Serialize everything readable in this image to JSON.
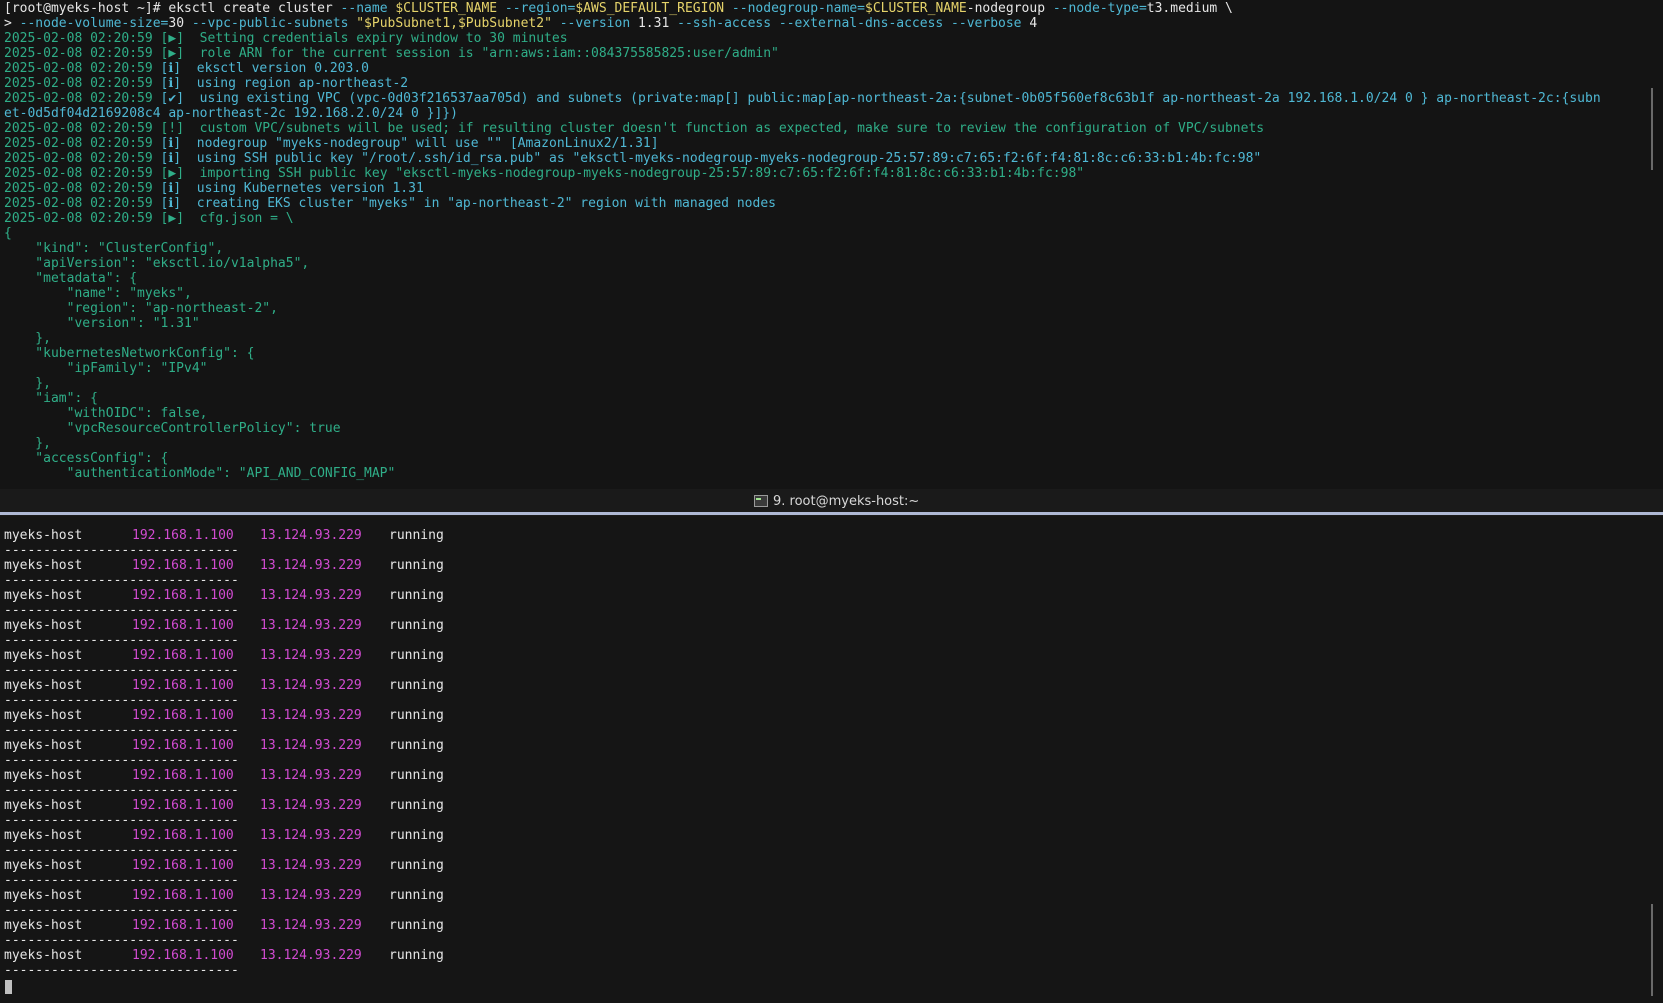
{
  "top_pane": {
    "command": {
      "prompt": "[root@myeks-host ~]#",
      "cmd": " eksctl create cluster",
      "flag1": " --name ",
      "var1": "$CLUSTER_NAME",
      "flag2": " --region=",
      "var2": "$AWS_DEFAULT_REGION",
      "flag3": " --nodegroup-name=",
      "var3": "$CLUSTER_NAME",
      "lit3": "-nodegroup",
      "flag4": " --node-type=",
      "lit4": "t3.medium \\"
    },
    "continuation": {
      "prompt": "> ",
      "flag1": "--node-volume-size=",
      "lit1": "30",
      "flag2": " --vpc-public-subnets ",
      "quote_open": "\"",
      "var1": "$PubSubnet1",
      "comma": ",",
      "var2": "$PubSubnet2",
      "quote_close": "\"",
      "flag3": " --version ",
      "lit3": "1.31",
      "flag4": " --ssh-access --external-dns-access --verbose ",
      "lit4": "4"
    },
    "log_lines": [
      {
        "ts": "2025-02-08 02:20:59",
        "marker": "[▶]",
        "msg": "  Setting credentials expiry window to 30 minutes",
        "color": "#2fae88"
      },
      {
        "ts": "2025-02-08 02:20:59",
        "marker": "[▶]",
        "msg": "  role ARN for the current session is \"arn:aws:iam::084375585825:user/admin\"",
        "color": "#2fae88"
      },
      {
        "ts": "2025-02-08 02:20:59",
        "marker": "[ℹ]",
        "msg": "  eksctl version 0.203.0",
        "color": "#4fb8d4"
      },
      {
        "ts": "2025-02-08 02:20:59",
        "marker": "[ℹ]",
        "msg": "  using region ap-northeast-2",
        "color": "#4fb8d4"
      },
      {
        "ts": "2025-02-08 02:20:59",
        "marker": "[✔]",
        "msg": "  using existing VPC (vpc-0d03f216537aa705d) and subnets (private:map[] public:map[ap-northeast-2a:{subnet-0b05f560ef8c63b1f ap-northeast-2a 192.168.1.0/24 0 } ap-northeast-2c:{subn",
        "color": "#4fb8d4"
      },
      {
        "ts": "",
        "marker": "",
        "msg": "et-0d5df04d2169208c4 ap-northeast-2c 192.168.2.0/24 0 }]})",
        "color": "#4fb8d4"
      },
      {
        "ts": "2025-02-08 02:20:59",
        "marker": "[!]",
        "msg": "  custom VPC/subnets will be used; if resulting cluster doesn't function as expected, make sure to review the configuration of VPC/subnets",
        "color": "#2fae88"
      },
      {
        "ts": "2025-02-08 02:20:59",
        "marker": "[ℹ]",
        "msg": "  nodegroup \"myeks-nodegroup\" will use \"\" [AmazonLinux2/1.31]",
        "color": "#4fb8d4"
      },
      {
        "ts": "2025-02-08 02:20:59",
        "marker": "[ℹ]",
        "msg": "  using SSH public key \"/root/.ssh/id_rsa.pub\" as \"eksctl-myeks-nodegroup-myeks-nodegroup-25:57:89:c7:65:f2:6f:f4:81:8c:c6:33:b1:4b:fc:98\"",
        "color": "#4fb8d4"
      },
      {
        "ts": "2025-02-08 02:20:59",
        "marker": "[▶]",
        "msg": "  importing SSH public key \"eksctl-myeks-nodegroup-myeks-nodegroup-25:57:89:c7:65:f2:6f:f4:81:8c:c6:33:b1:4b:fc:98\"",
        "color": "#2fae88"
      },
      {
        "ts": "2025-02-08 02:20:59",
        "marker": "[ℹ]",
        "msg": "  using Kubernetes version 1.31",
        "color": "#4fb8d4"
      },
      {
        "ts": "2025-02-08 02:20:59",
        "marker": "[ℹ]",
        "msg": "  creating EKS cluster \"myeks\" in \"ap-northeast-2\" region with managed nodes",
        "color": "#4fb8d4"
      },
      {
        "ts": "2025-02-08 02:20:59",
        "marker": "[▶]",
        "msg": "  cfg.json = \\",
        "color": "#2fae88"
      }
    ],
    "json_lines": [
      "{",
      "    \"kind\": \"ClusterConfig\",",
      "    \"apiVersion\": \"eksctl.io/v1alpha5\",",
      "    \"metadata\": {",
      "        \"name\": \"myeks\",",
      "        \"region\": \"ap-northeast-2\",",
      "        \"version\": \"1.31\"",
      "    },",
      "    \"kubernetesNetworkConfig\": {",
      "        \"ipFamily\": \"IPv4\"",
      "    },",
      "    \"iam\": {",
      "        \"withOIDC\": false,",
      "        \"vpcResourceControllerPolicy\": true",
      "    },",
      "    \"accessConfig\": {",
      "        \"authenticationMode\": \"API_AND_CONFIG_MAP\""
    ]
  },
  "divider": {
    "icon": "terminal-icon",
    "title": "9. root@myeks-host:~",
    "accent_color": "#aeb8d4"
  },
  "bottom_pane": {
    "rows": [
      {
        "host": "myeks-host",
        "private_ip": "192.168.1.100",
        "public_ip": "13.124.93.229",
        "state": "running"
      },
      {
        "host": "myeks-host",
        "private_ip": "192.168.1.100",
        "public_ip": "13.124.93.229",
        "state": "running"
      },
      {
        "host": "myeks-host",
        "private_ip": "192.168.1.100",
        "public_ip": "13.124.93.229",
        "state": "running"
      },
      {
        "host": "myeks-host",
        "private_ip": "192.168.1.100",
        "public_ip": "13.124.93.229",
        "state": "running"
      },
      {
        "host": "myeks-host",
        "private_ip": "192.168.1.100",
        "public_ip": "13.124.93.229",
        "state": "running"
      },
      {
        "host": "myeks-host",
        "private_ip": "192.168.1.100",
        "public_ip": "13.124.93.229",
        "state": "running"
      },
      {
        "host": "myeks-host",
        "private_ip": "192.168.1.100",
        "public_ip": "13.124.93.229",
        "state": "running"
      },
      {
        "host": "myeks-host",
        "private_ip": "192.168.1.100",
        "public_ip": "13.124.93.229",
        "state": "running"
      },
      {
        "host": "myeks-host",
        "private_ip": "192.168.1.100",
        "public_ip": "13.124.93.229",
        "state": "running"
      },
      {
        "host": "myeks-host",
        "private_ip": "192.168.1.100",
        "public_ip": "13.124.93.229",
        "state": "running"
      },
      {
        "host": "myeks-host",
        "private_ip": "192.168.1.100",
        "public_ip": "13.124.93.229",
        "state": "running"
      },
      {
        "host": "myeks-host",
        "private_ip": "192.168.1.100",
        "public_ip": "13.124.93.229",
        "state": "running"
      },
      {
        "host": "myeks-host",
        "private_ip": "192.168.1.100",
        "public_ip": "13.124.93.229",
        "state": "running"
      },
      {
        "host": "myeks-host",
        "private_ip": "192.168.1.100",
        "public_ip": "13.124.93.229",
        "state": "running"
      },
      {
        "host": "myeks-host",
        "private_ip": "192.168.1.100",
        "public_ip": "13.124.93.229",
        "state": "running"
      }
    ],
    "separator": "------------------------------"
  },
  "colors": {
    "background": "#141414",
    "prompt": "#e6e6e6",
    "variable": "#e5d36a",
    "flag": "#4fb8d4",
    "info": "#4fb8d4",
    "progress": "#2fae88",
    "ip": "#d14bd1"
  }
}
